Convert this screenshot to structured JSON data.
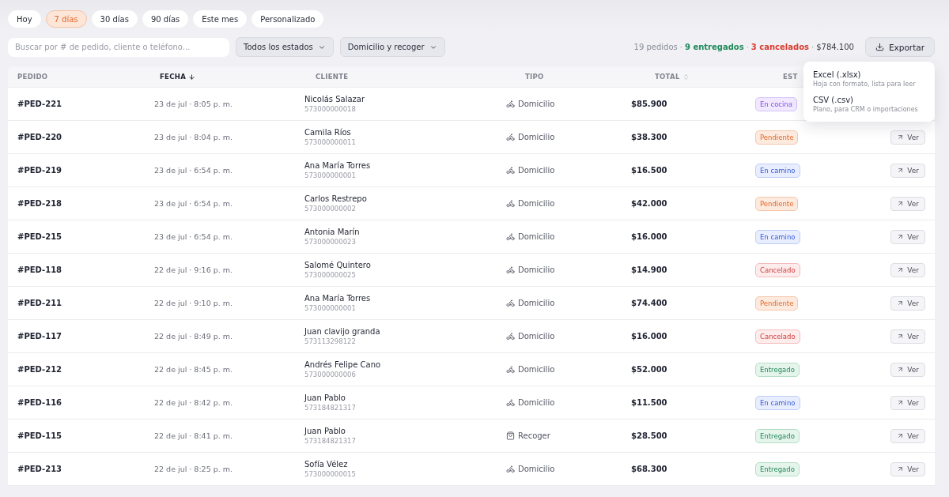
{
  "ranges": [
    {
      "label": "Hoy",
      "selected": false
    },
    {
      "label": "7 días",
      "selected": true
    },
    {
      "label": "30 días",
      "selected": false
    },
    {
      "label": "90 días",
      "selected": false
    },
    {
      "label": "Este mes",
      "selected": false
    },
    {
      "label": "Personalizado",
      "selected": false
    }
  ],
  "search": {
    "placeholder": "Buscar por # de pedido, cliente o teléfono..."
  },
  "filters": [
    "Todos los estados",
    "Domicilio y recoger"
  ],
  "summary": {
    "separator": "·",
    "parts": [
      {
        "text": "19 pedidos",
        "color": "#8b8e98"
      },
      {
        "text": "9 entregados",
        "color": "#1f8a5a"
      },
      {
        "text": "3 cancelados",
        "color": "#d93a2f"
      },
      {
        "text": "$784.100",
        "color": "#3a3d48"
      }
    ]
  },
  "export_button": {
    "label": "Exportar"
  },
  "export_menu": [
    {
      "title": "Excel (.xlsx)",
      "hint": "Hoja con formato, lista para leer"
    },
    {
      "title": "CSV (.csv)",
      "hint": "Plano, para CRM o importaciones"
    }
  ],
  "table": {
    "columns": [
      {
        "label": "PEDIDO",
        "kind": "plain"
      },
      {
        "label": "FECHA",
        "kind": "sorted"
      },
      {
        "label": "CLIENTE",
        "kind": "plain"
      },
      {
        "label": "TIPO",
        "kind": "plain"
      },
      {
        "label": "TOTAL",
        "kind": "sortable"
      },
      {
        "label": "EST",
        "kind": "plain"
      }
    ],
    "rows": [
      {
        "order": "#PED-221",
        "date": "23 de jul · 8:05 p. m.",
        "client": "Nicolás Salazar",
        "phone": "573000000018",
        "type": {
          "kind": "domicilio",
          "label": "Domicilio"
        },
        "total": "$85.900",
        "status": {
          "kind": "cocina",
          "label": "En cocina"
        }
      },
      {
        "order": "#PED-220",
        "date": "23 de jul · 8:04 p. m.",
        "client": "Camila Ríos",
        "phone": "573000000011",
        "type": {
          "kind": "domicilio",
          "label": "Domicilio"
        },
        "total": "$38.300",
        "status": {
          "kind": "pendiente",
          "label": "Pendiente"
        },
        "action": "Ver"
      },
      {
        "order": "#PED-219",
        "date": "23 de jul · 6:54 p. m.",
        "client": "Ana María Torres",
        "phone": "573000000001",
        "type": {
          "kind": "domicilio",
          "label": "Domicilio"
        },
        "total": "$16.500",
        "status": {
          "kind": "camino",
          "label": "En camino"
        },
        "action": "Ver"
      },
      {
        "order": "#PED-218",
        "date": "23 de jul · 6:54 p. m.",
        "client": "Carlos Restrepo",
        "phone": "573000000002",
        "type": {
          "kind": "domicilio",
          "label": "Domicilio"
        },
        "total": "$42.000",
        "status": {
          "kind": "pendiente",
          "label": "Pendiente"
        },
        "action": "Ver"
      },
      {
        "order": "#PED-215",
        "date": "23 de jul · 6:54 p. m.",
        "client": "Antonia Marín",
        "phone": "573000000023",
        "type": {
          "kind": "domicilio",
          "label": "Domicilio"
        },
        "total": "$16.000",
        "status": {
          "kind": "camino",
          "label": "En camino"
        },
        "action": "Ver"
      },
      {
        "order": "#PED-118",
        "date": "22 de jul · 9:16 p. m.",
        "client": "Salomé Quintero",
        "phone": "573000000025",
        "type": {
          "kind": "domicilio",
          "label": "Domicilio"
        },
        "total": "$14.900",
        "status": {
          "kind": "cancelado",
          "label": "Cancelado"
        },
        "action": "Ver"
      },
      {
        "order": "#PED-211",
        "date": "22 de jul · 9:10 p. m.",
        "client": "Ana María Torres",
        "phone": "573000000001",
        "type": {
          "kind": "domicilio",
          "label": "Domicilio"
        },
        "total": "$74.400",
        "status": {
          "kind": "pendiente",
          "label": "Pendiente"
        },
        "action": "Ver"
      },
      {
        "order": "#PED-117",
        "date": "22 de jul · 8:49 p. m.",
        "client": "Juan clavijo granda",
        "phone": "573113298122",
        "type": {
          "kind": "domicilio",
          "label": "Domicilio"
        },
        "total": "$16.000",
        "status": {
          "kind": "cancelado",
          "label": "Cancelado"
        },
        "action": "Ver"
      },
      {
        "order": "#PED-212",
        "date": "22 de jul · 8:45 p. m.",
        "client": "Andrés Felipe Cano",
        "phone": "573000000006",
        "type": {
          "kind": "domicilio",
          "label": "Domicilio"
        },
        "total": "$52.000",
        "status": {
          "kind": "entregado",
          "label": "Entregado"
        },
        "action": "Ver"
      },
      {
        "order": "#PED-116",
        "date": "22 de jul · 8:42 p. m.",
        "client": "Juan Pablo",
        "phone": "573184821317",
        "type": {
          "kind": "domicilio",
          "label": "Domicilio"
        },
        "total": "$11.500",
        "status": {
          "kind": "camino",
          "label": "En camino"
        },
        "action": "Ver"
      },
      {
        "order": "#PED-115",
        "date": "22 de jul · 8:41 p. m.",
        "client": "Juan Pablo",
        "phone": "573184821317",
        "type": {
          "kind": "recoger",
          "label": "Recoger"
        },
        "total": "$28.500",
        "status": {
          "kind": "entregado",
          "label": "Entregado"
        },
        "action": "Ver"
      },
      {
        "order": "#PED-213",
        "date": "22 de jul · 8:25 p. m.",
        "client": "Sofía Vélez",
        "phone": "573000000015",
        "type": {
          "kind": "domicilio",
          "label": "Domicilio"
        },
        "total": "$68.300",
        "status": {
          "kind": "entregado",
          "label": "Entregado"
        },
        "action": "Ver"
      }
    ]
  }
}
